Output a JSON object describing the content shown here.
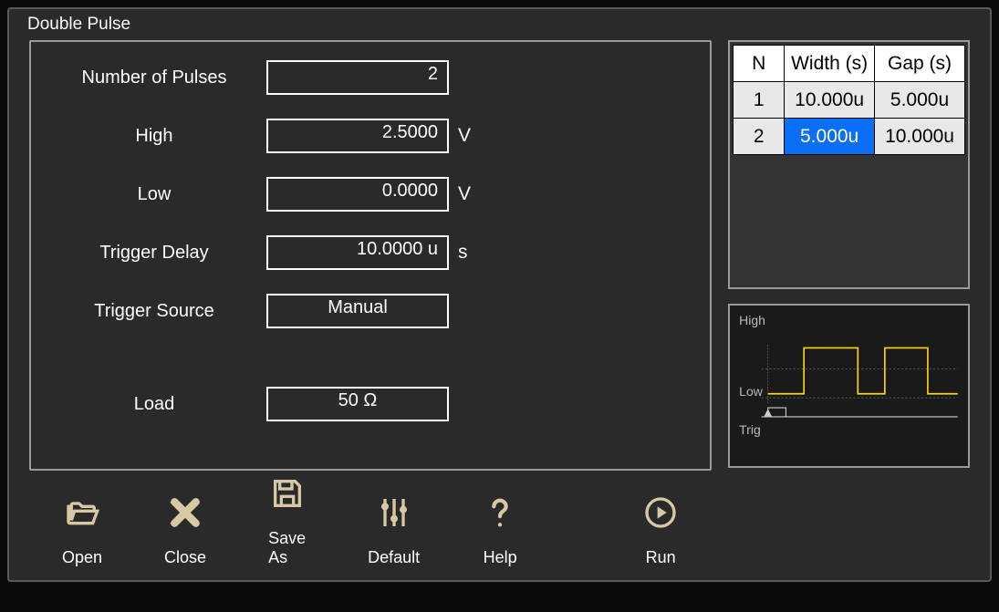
{
  "title": "Double Pulse",
  "params": {
    "numPulses": {
      "label": "Number of Pulses",
      "value": "2"
    },
    "high": {
      "label": "High",
      "value": "2.5000",
      "unit": "V"
    },
    "low": {
      "label": "Low",
      "value": "0.0000",
      "unit": "V"
    },
    "trigDelay": {
      "label": "Trigger Delay",
      "value": "10.0000 u",
      "unit": "s"
    },
    "trigSrc": {
      "label": "Trigger Source",
      "value": "Manual"
    },
    "load": {
      "label": "Load",
      "value": "50 Ω"
    }
  },
  "table": {
    "headers": {
      "n": "N",
      "width": "Width (s)",
      "gap": "Gap (s)"
    },
    "rows": [
      {
        "n": "1",
        "width": "10.000u",
        "gap": "5.000u",
        "widthSelected": false
      },
      {
        "n": "2",
        "width": "5.000u",
        "gap": "10.000u",
        "widthSelected": true
      }
    ]
  },
  "waveform": {
    "labels": {
      "high": "High",
      "low": "Low",
      "trig": "Trig"
    }
  },
  "toolbar": {
    "open": "Open",
    "close": "Close",
    "saveAs": "Save As",
    "default": "Default",
    "help": "Help",
    "run": "Run"
  }
}
